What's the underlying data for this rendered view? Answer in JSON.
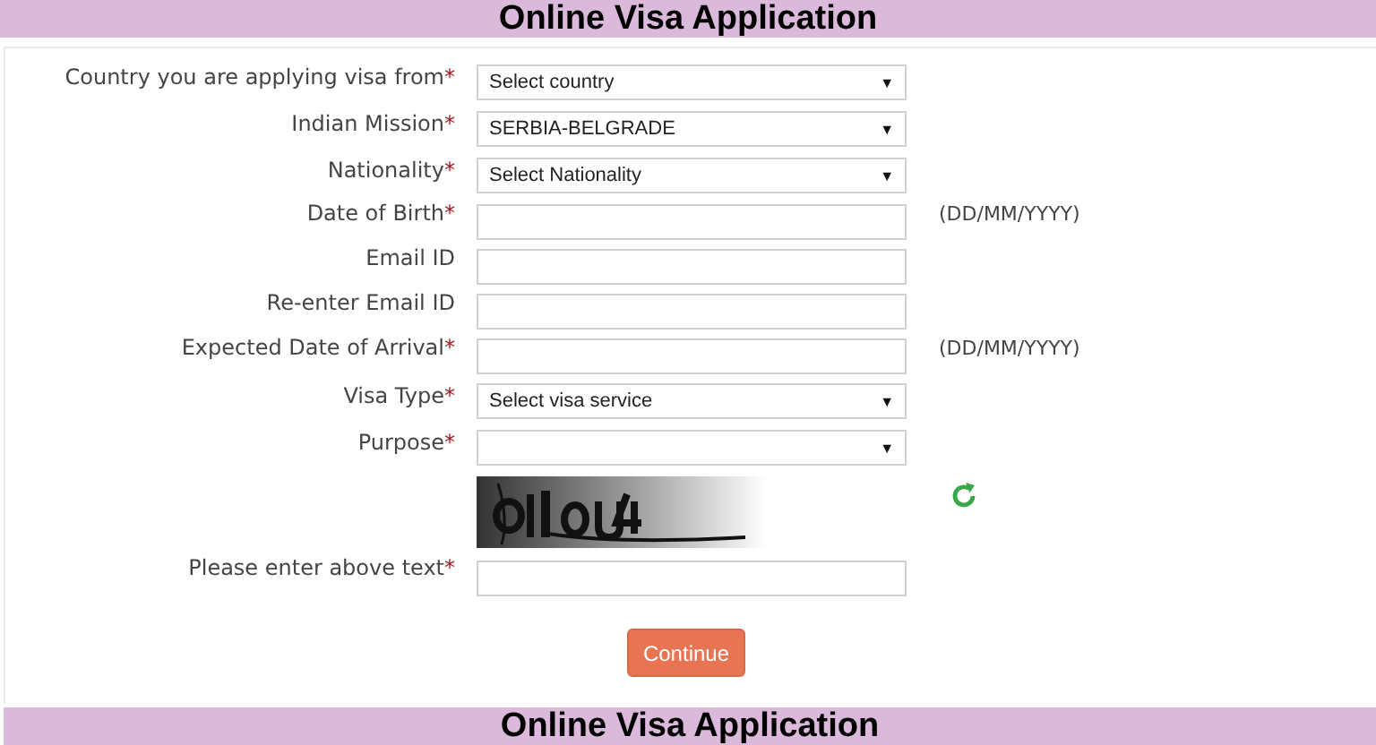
{
  "header": {
    "title": "Online Visa Application"
  },
  "form": {
    "fields": [
      {
        "kind": "select",
        "label": "Country you are applying visa from",
        "required": true,
        "value": "Select country"
      },
      {
        "kind": "select",
        "label": "Indian Mission",
        "required": true,
        "value": "SERBIA-BELGRADE"
      },
      {
        "kind": "select",
        "label": "Nationality",
        "required": true,
        "value": "Select Nationality"
      },
      {
        "kind": "input",
        "label": "Date of Birth",
        "required": true,
        "hint": "(DD/MM/YYYY)"
      },
      {
        "kind": "input",
        "label": "Email ID",
        "required": false
      },
      {
        "kind": "input",
        "label": "Re-enter Email ID",
        "required": false
      },
      {
        "kind": "input",
        "label": "Expected Date of Arrival",
        "required": true,
        "hint": "(DD/MM/YYYY)"
      },
      {
        "kind": "select",
        "label": "Visa Type",
        "required": true,
        "value": "Select visa service"
      },
      {
        "kind": "select",
        "label": "Purpose",
        "required": true
      },
      {
        "kind": "captcha"
      },
      {
        "kind": "input",
        "label": "Please enter above text",
        "required": true
      }
    ],
    "required_mark": "*",
    "dropdown_arrow": "▼",
    "submit": "Continue"
  },
  "footer": {
    "title": "Online Visa Application"
  }
}
